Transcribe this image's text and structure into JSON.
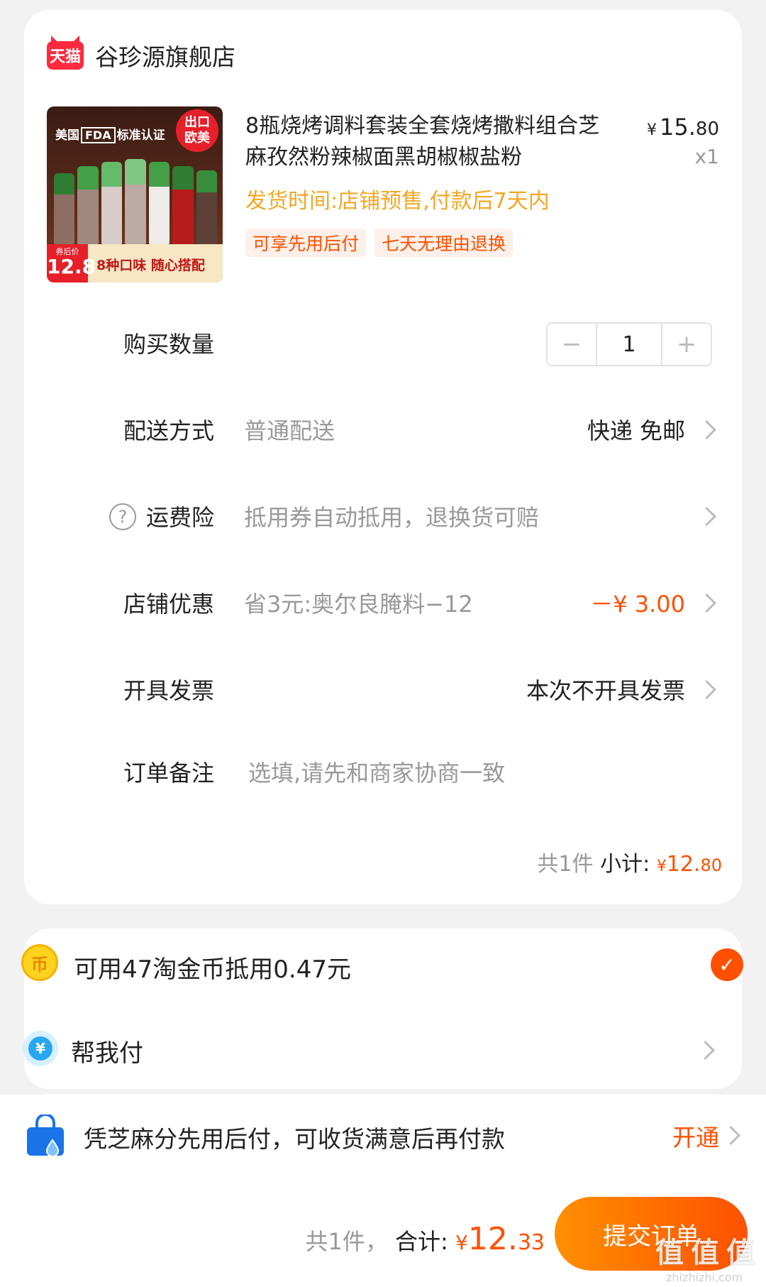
{
  "store": {
    "badge": "天猫",
    "name": "谷珍源旗舰店"
  },
  "product": {
    "title": "8瓶烧烤调料套装全套烧烤撒料组合芝麻孜然粉辣椒面黑胡椒椒盐粉",
    "price_yen": "¥",
    "price_int": "15.",
    "price_dec": "80",
    "qty": "x1",
    "ship_time": "发货时间:店铺预售,付款后7天内",
    "tags": [
      "可享先用后付",
      "七天无理由退换"
    ],
    "image": {
      "top_text_1": "美国",
      "top_fda": "FDA",
      "top_text_2": "标准认证",
      "badge_1": "出口",
      "badge_2": "欧美",
      "price_label": "券后价",
      "price": "12.8",
      "slogan": "8种口味 随心搭配"
    }
  },
  "quantity": {
    "label": "购买数量",
    "minus": "−",
    "value": "1",
    "plus": "+"
  },
  "delivery": {
    "label": "配送方式",
    "sub": "普通配送",
    "value": "快递 免邮"
  },
  "freight_insurance": {
    "icon": "?",
    "label": "运费险",
    "sub": "抵用券自动抵用，退换货可赔"
  },
  "store_discount": {
    "label": "店铺优惠",
    "sub": "省3元:奥尔良腌料−12",
    "value": "－¥ 3.00"
  },
  "invoice": {
    "label": "开具发票",
    "value": "本次不开具发票"
  },
  "note": {
    "label": "订单备注",
    "placeholder": "选填,请先和商家协商一致"
  },
  "subtotal": {
    "count": "共1件",
    "label": "小计:",
    "yen": "¥",
    "int": "12.",
    "dec": "80"
  },
  "coins": {
    "icon": "币",
    "text": "可用47淘金币抵用0.47元",
    "check": "✓"
  },
  "help_pay": {
    "icon": "¥",
    "text": "帮我付"
  },
  "credit": {
    "text": "凭芝麻分先用后付，可收货满意后再付款",
    "action": "开通"
  },
  "total": {
    "count": "共1件，",
    "label": "合计:",
    "yen": "¥",
    "int": "12.",
    "dec": "33"
  },
  "submit": {
    "label": "提交订单"
  },
  "watermark": {
    "logo": "值 值 值",
    "url": "zhizhizhi.com"
  },
  "colors": {
    "accent": "#ff5000",
    "ship_time": "#f5a623",
    "tmall_red": "#ff2a3d"
  }
}
